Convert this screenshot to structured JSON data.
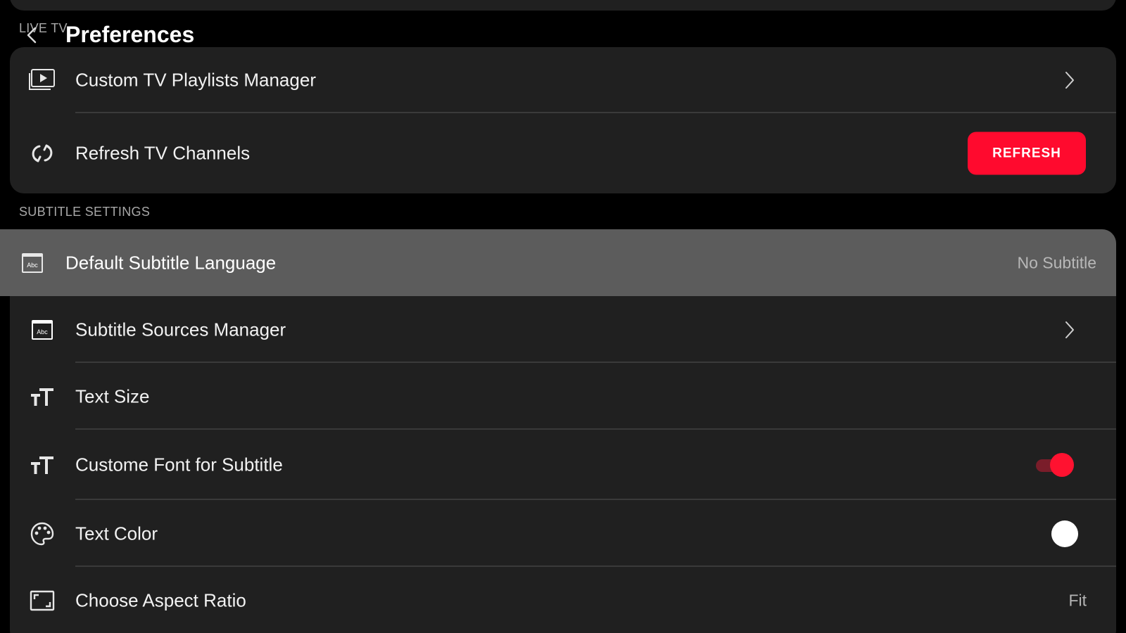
{
  "header": {
    "section_label": "LIVE TV",
    "title": "Preferences"
  },
  "live_tv": {
    "items": [
      {
        "label": "Custom TV Playlists Manager",
        "icon": "playlist-tv-icon",
        "accessory": "chevron"
      },
      {
        "label": "Refresh TV Channels",
        "icon": "refresh-icon",
        "accessory": "button",
        "button_label": "REFRESH"
      }
    ]
  },
  "subtitle_settings": {
    "section_label": "SUBTITLE SETTINGS",
    "highlighted": {
      "label": "Default Subtitle Language",
      "icon": "subtitle-abc-icon",
      "value": "No Subtitle"
    },
    "items": [
      {
        "label": "Subtitle Sources Manager",
        "icon": "subtitle-abc-icon",
        "accessory": "chevron"
      },
      {
        "label": "Text Size",
        "icon": "text-size-icon"
      },
      {
        "label": "Custome Font for Subtitle",
        "icon": "text-size-icon",
        "accessory": "toggle",
        "toggle_on": true
      },
      {
        "label": "Text Color",
        "icon": "palette-icon",
        "accessory": "color",
        "color_value": "#ffffff"
      },
      {
        "label": "Choose Aspect Ratio",
        "icon": "aspect-ratio-icon",
        "value": "Fit"
      }
    ]
  },
  "icon_text": {
    "abc": "Abc"
  },
  "colors": {
    "accent": "#ff0a2e",
    "card_bg": "#202020",
    "highlight_bg": "#5c5c5c",
    "page_bg": "#000000"
  }
}
